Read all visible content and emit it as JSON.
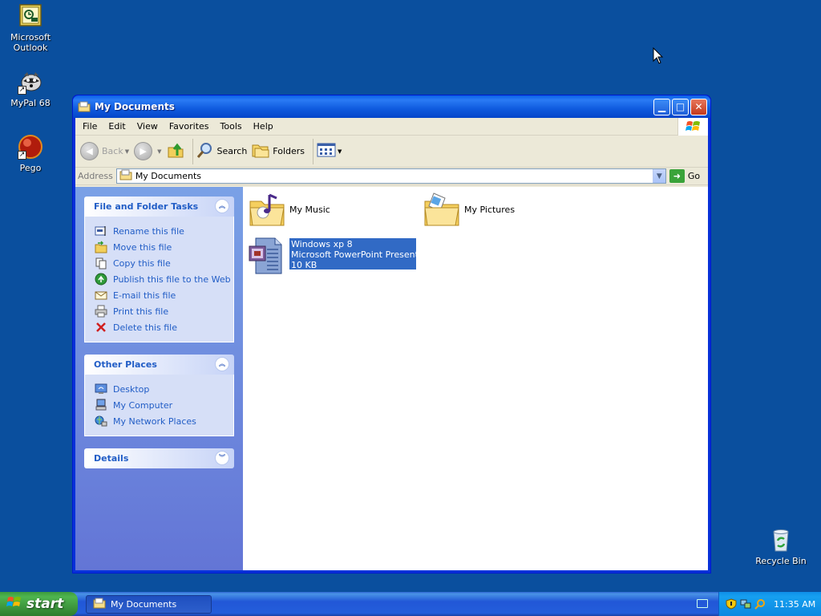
{
  "desktop": {
    "icons": [
      {
        "label": "Microsoft Outlook"
      },
      {
        "label": "MyPal 68"
      },
      {
        "label": "Pego"
      },
      {
        "label": "Recycle Bin"
      }
    ]
  },
  "window": {
    "title": "My Documents",
    "menu": [
      "File",
      "Edit",
      "View",
      "Favorites",
      "Tools",
      "Help"
    ],
    "toolbar": {
      "back_label": "Back",
      "search_label": "Search",
      "folders_label": "Folders"
    },
    "address": {
      "label": "Address",
      "value": "My Documents",
      "go_label": "Go"
    },
    "task_pane": {
      "file_tasks": {
        "title": "File and Folder Tasks",
        "links": [
          "Rename this file",
          "Move this file",
          "Copy this file",
          "Publish this file to the Web",
          "E-mail this file",
          "Print this file",
          "Delete this file"
        ]
      },
      "other_places": {
        "title": "Other Places",
        "links": [
          "Desktop",
          "My Computer",
          "My Network Places"
        ]
      },
      "details": {
        "title": "Details"
      }
    },
    "items": [
      {
        "name": "My Music"
      },
      {
        "name": "My Pictures"
      },
      {
        "name": "Windows xp 8",
        "type": "Microsoft PowerPoint Present...",
        "size": "10 KB",
        "selected": true
      }
    ]
  },
  "taskbar": {
    "start_label": "start",
    "task_button_label": "My Documents",
    "clock": "11:35 AM"
  },
  "colors": {
    "desktop": "#0a4f9e",
    "selection": "#316ac5",
    "link": "#215dc6",
    "start_green": "#3c9a3c"
  }
}
